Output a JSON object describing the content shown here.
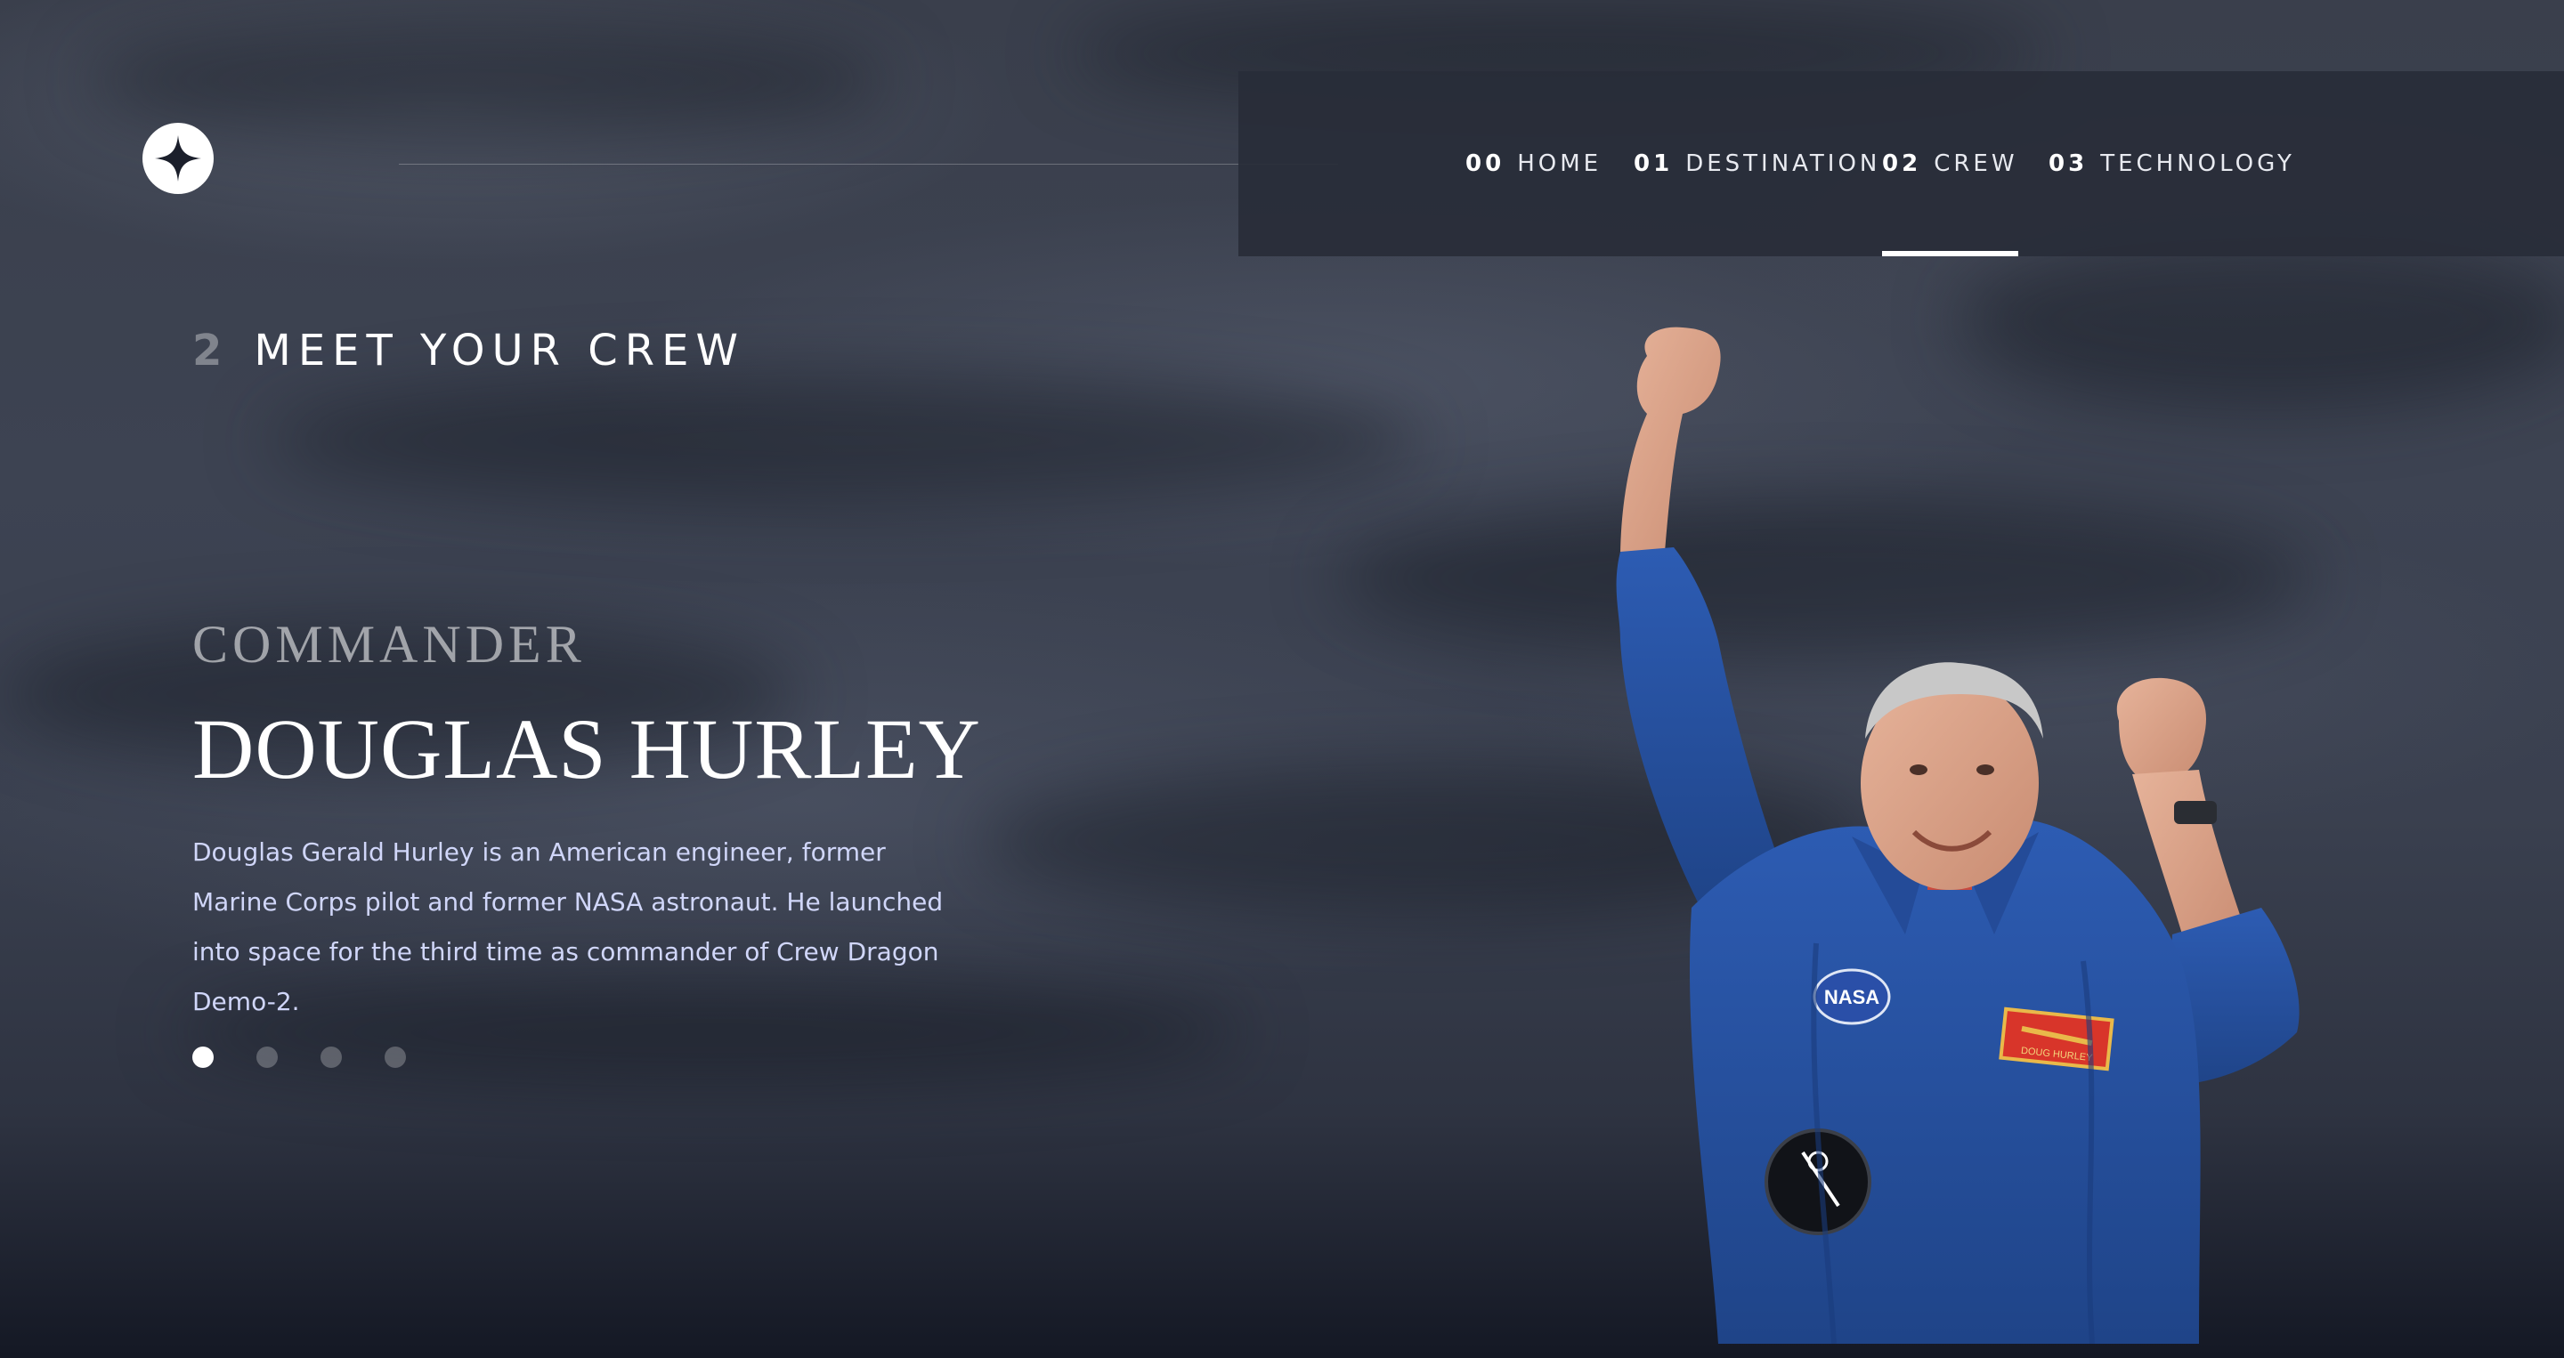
{
  "nav": {
    "items": [
      {
        "num": "00",
        "label": "HOME"
      },
      {
        "num": "01",
        "label": "DESTINATION"
      },
      {
        "num": "02",
        "label": "CREW"
      },
      {
        "num": "03",
        "label": "TECHNOLOGY"
      }
    ],
    "active_index": 2
  },
  "page": {
    "eyebrow_num": "2",
    "eyebrow_label": "MEET YOUR CREW"
  },
  "crew": {
    "role": "COMMANDER",
    "name": "DOUGLAS HURLEY",
    "bio": "Douglas Gerald Hurley is an American engineer, former Marine Corps pilot and former NASA astronaut. He launched into space for the third time as commander of Crew Dragon Demo-2.",
    "patch_text": "DOUG HURLEY"
  },
  "pagination": {
    "count": 4,
    "active_index": 0
  },
  "colors": {
    "background": "#1b1f2b",
    "nav_background": "#282c38",
    "text_primary": "#ffffff",
    "text_secondary": "#d0d6f9",
    "suit_blue": "#2a55a8"
  },
  "icons": {
    "logo": "four-point-star-logo-icon"
  }
}
